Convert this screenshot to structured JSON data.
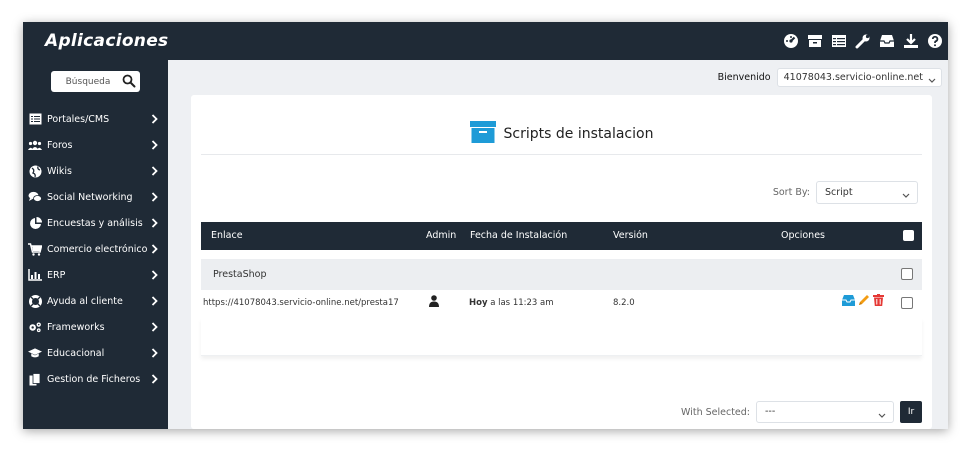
{
  "app": {
    "title": "Aplicaciones"
  },
  "top_icons": [
    "dashboard-icon",
    "archive-icon",
    "list-icon",
    "wrench-icon",
    "inbox-icon",
    "download-icon",
    "help-icon"
  ],
  "search": {
    "placeholder": "Búsqueda"
  },
  "sidebar": {
    "items": [
      {
        "label": "Portales/CMS",
        "icon": "list-icon"
      },
      {
        "label": "Foros",
        "icon": "users-icon"
      },
      {
        "label": "Wikis",
        "icon": "globe-icon"
      },
      {
        "label": "Social Networking",
        "icon": "comments-icon"
      },
      {
        "label": "Encuestas y análisis",
        "icon": "pie-chart-icon"
      },
      {
        "label": "Comercio electrónico",
        "icon": "cart-icon"
      },
      {
        "label": "ERP",
        "icon": "line-chart-icon"
      },
      {
        "label": "Ayuda al cliente",
        "icon": "lifebuoy-icon"
      },
      {
        "label": "Frameworks",
        "icon": "cogs-icon"
      },
      {
        "label": "Educacional",
        "icon": "graduation-cap-icon"
      },
      {
        "label": "Gestion de Ficheros",
        "icon": "files-icon"
      }
    ]
  },
  "header": {
    "welcome_label": "Bienvenido",
    "user": "41078043.servicio-online.net"
  },
  "main": {
    "title": "Scripts de instalacion",
    "sort_label": "Sort By:",
    "sort_value": "Script",
    "columns": [
      "Enlace",
      "Admin",
      "Fecha de Instalación",
      "Versión",
      "Opciones"
    ],
    "group": "PrestaShop",
    "rows": [
      {
        "link": "https://41078043.servicio-online.net/presta17",
        "date_bold": "Hoy",
        "date_rest": "a las 11:23 am",
        "version": "8.2.0"
      }
    ],
    "with_selected_label": "With Selected:",
    "with_selected_value": "---",
    "go_label": "Ir"
  },
  "colors": {
    "dark": "#1f2a36",
    "accent_blue": "#1e9bd7",
    "accent_orange": "#f39c12",
    "accent_red": "#e53935"
  }
}
